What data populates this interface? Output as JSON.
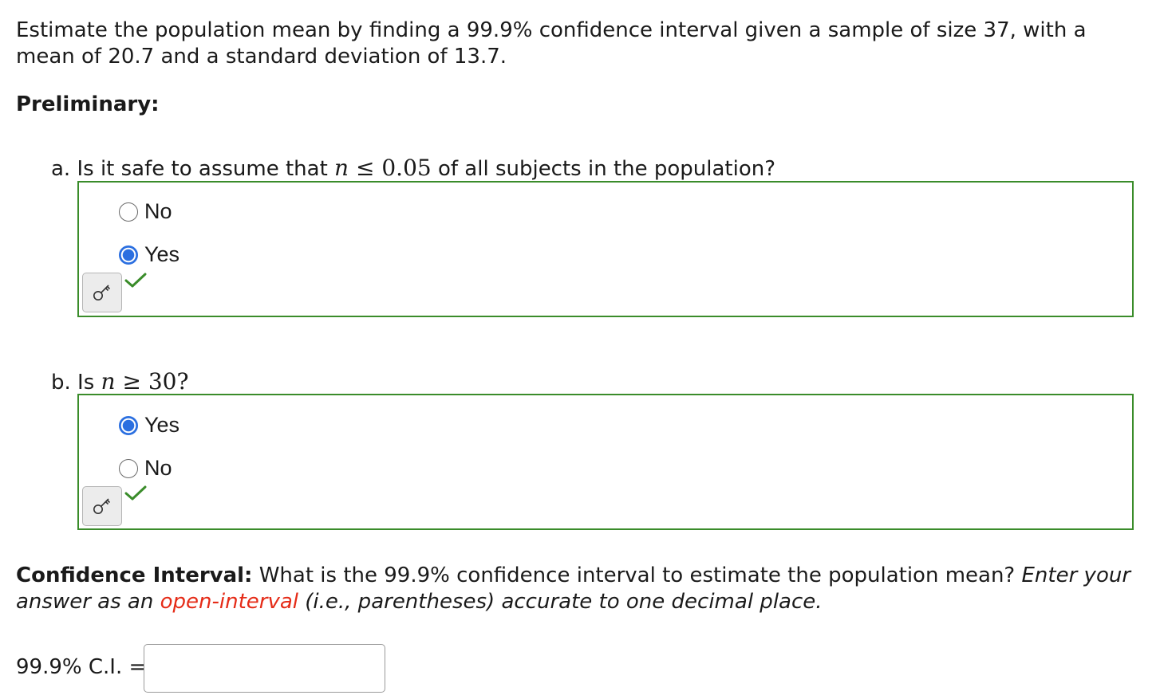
{
  "intro": {
    "line1": "Estimate the population mean by finding a 99.9% confidence interval given a sample of size 37, with a",
    "line2": "mean of 20.7 and a standard deviation of 13.7."
  },
  "preliminary_heading": "Preliminary:",
  "question_a": {
    "prefix": "a. Is it safe to assume that ",
    "math_var": "n",
    "math_rel": " ≤ 0.05",
    "suffix": " of all subjects in the population?",
    "options": [
      {
        "label": "No",
        "selected": false
      },
      {
        "label": "Yes",
        "selected": true
      }
    ],
    "status": "correct"
  },
  "question_b": {
    "prefix": "b. Is ",
    "math_var": "n",
    "math_rel": " ≥ 30?",
    "options": [
      {
        "label": "Yes",
        "selected": true
      },
      {
        "label": "No",
        "selected": false
      }
    ],
    "status": "correct"
  },
  "confidence_interval": {
    "heading_bold": "Confidence Interval:",
    "heading_text": " What is the 99.9% confidence interval to estimate the population mean? ",
    "instruction_1": "Enter your",
    "instruction_2": "answer as an ",
    "instruction_link": "open-interval",
    "instruction_3": " (i.e., parentheses) accurate to one decimal place.",
    "input_label": "99.9% C.I. =",
    "input_value": ""
  },
  "icons": {
    "key_button": "key-icon",
    "correct_mark": "checkmark-icon"
  },
  "colors": {
    "correct_border": "#3a8c2a",
    "checkmark": "#3a8c2a",
    "radio_selected": "#2b6fe0",
    "highlight_text": "#e52b17"
  }
}
